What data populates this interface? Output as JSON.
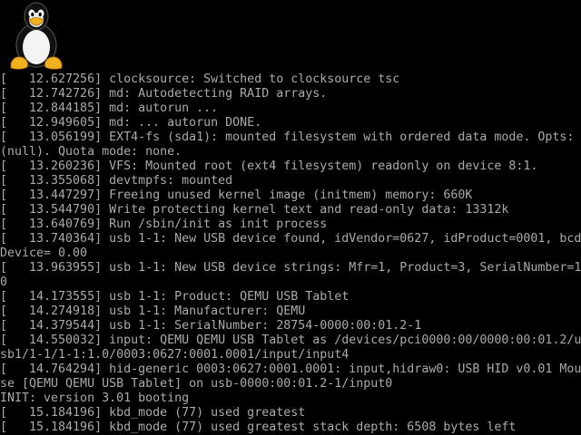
{
  "logo": {
    "icon": "tux-penguin-icon"
  },
  "colors": {
    "background": "#000000",
    "text": "#aaaaaa",
    "tux_beak_feet": "#f0b020"
  },
  "console": {
    "lines": [
      "[   12.627256] clocksource: Switched to clocksource tsc",
      "[   12.742726] md: Autodetecting RAID arrays.",
      "[   12.844185] md: autorun ...",
      "[   12.949605] md: ... autorun DONE.",
      "[   13.056199] EXT4-fs (sda1): mounted filesystem with ordered data mode. Opts:",
      "(null). Quota mode: none.",
      "[   13.260236] VFS: Mounted root (ext4 filesystem) readonly on device 8:1.",
      "[   13.355068] devtmpfs: mounted",
      "[   13.447297] Freeing unused kernel image (initmem) memory: 660K",
      "[   13.544790] Write protecting kernel text and read-only data: 13312k",
      "[   13.640769] Run /sbin/init as init process",
      "[   13.740364] usb 1-1: New USB device found, idVendor=0627, idProduct=0001, bcd",
      "Device= 0.00",
      "[   13.963955] usb 1-1: New USB device strings: Mfr=1, Product=3, SerialNumber=1",
      "0",
      "[   14.173555] usb 1-1: Product: QEMU USB Tablet",
      "[   14.274918] usb 1-1: Manufacturer: QEMU",
      "[   14.379544] usb 1-1: SerialNumber: 28754-0000:00:01.2-1",
      "[   14.550032] input: QEMU QEMU USB Tablet as /devices/pci0000:00/0000:00:01.2/u",
      "sb1/1-1/1-1:1.0/0003:0627:0001.0001/input/input4",
      "[   14.764294] hid-generic 0003:0627:0001.0001: input,hidraw0: USB HID v0.01 Mou",
      "se [QEMU QEMU USB Tablet] on usb-0000:00:01.2-1/input0",
      "INIT: version 3.01 booting",
      "[   15.184196] kbd_mode (77) used greatest",
      "[   15.184196] kbd_mode (77) used greatest stack depth: 6508 bytes left"
    ]
  }
}
